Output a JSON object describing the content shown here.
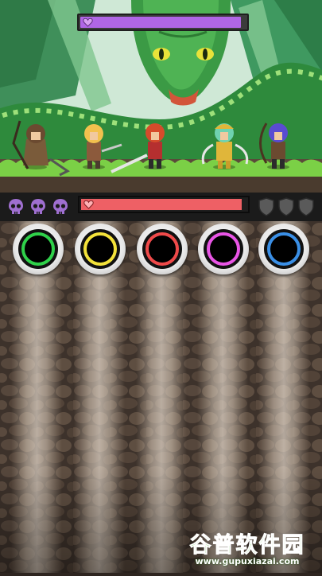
{
  "boss": {
    "name": "green-serpent-boss",
    "health_fraction": 0.97,
    "bar_color": "#b066e6"
  },
  "party": {
    "health_fraction": 0.97,
    "bar_color": "#ee6065",
    "heroes": [
      {
        "id": "hero-druid",
        "hair": "#6b4a30",
        "outfit": "#7a5b3a",
        "weapon": "scythe"
      },
      {
        "id": "hero-blonde-warrior",
        "hair": "#f2c14e",
        "outfit": "#8c5a3c",
        "weapon": "sword"
      },
      {
        "id": "hero-red-swordsman",
        "hair": "#d64b2b",
        "outfit": "#b52f2f",
        "weapon": "sword"
      },
      {
        "id": "hero-green-knight",
        "hair": "#6fd2b0",
        "outfit": "#e0b63a",
        "weapon": "twin-blades"
      },
      {
        "id": "hero-blue-archer",
        "hair": "#5a4bd1",
        "outfit": "#6b4a30",
        "weapon": "bow"
      }
    ]
  },
  "combo_skulls": {
    "count": 3,
    "icon": "skull-icon",
    "color": "#9f6fd0"
  },
  "shields": {
    "count": 3,
    "icon": "shield-icon",
    "color": "#5a5a5a"
  },
  "lanes": [
    {
      "id": "green",
      "color": "#2fd14a"
    },
    {
      "id": "yellow",
      "color": "#f3e23a"
    },
    {
      "id": "red",
      "color": "#ef4a4a"
    },
    {
      "id": "pink",
      "color": "#e955e6"
    },
    {
      "id": "blue",
      "color": "#3a8fe6"
    }
  ],
  "watermark": {
    "title": "谷普软件园",
    "url": "www.gupuxiazai.com"
  }
}
